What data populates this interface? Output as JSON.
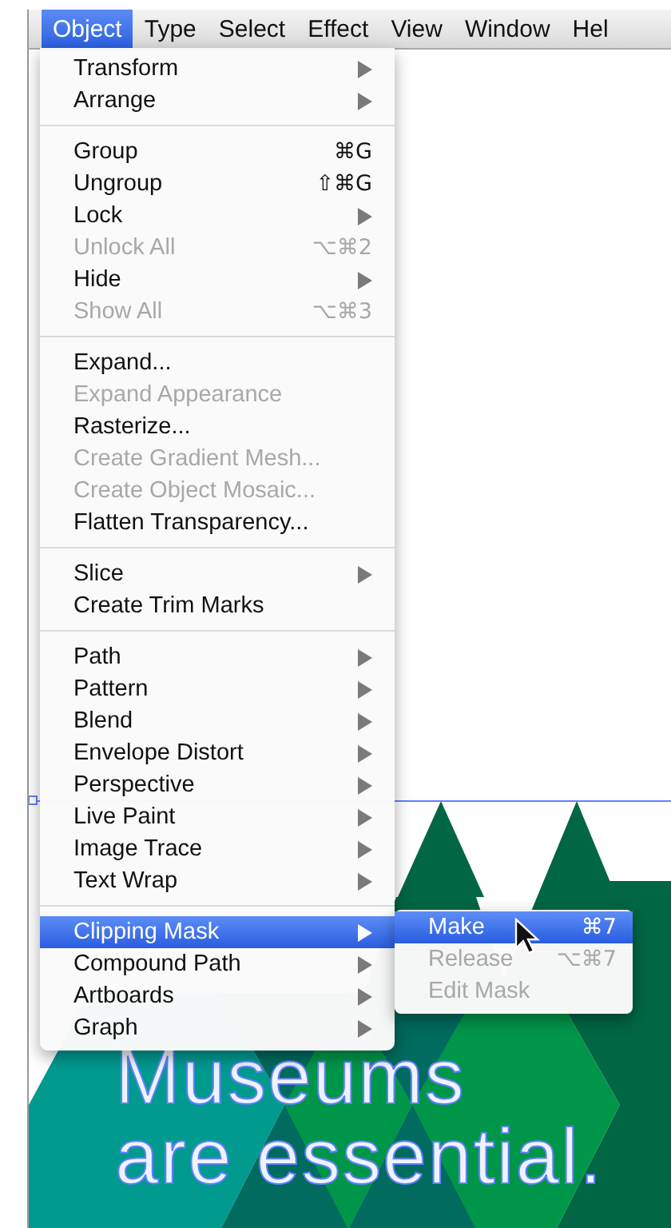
{
  "menubar": [
    {
      "label": "Object",
      "selected": true
    },
    {
      "label": "Type",
      "selected": false
    },
    {
      "label": "Select",
      "selected": false
    },
    {
      "label": "Effect",
      "selected": false
    },
    {
      "label": "View",
      "selected": false
    },
    {
      "label": "Window",
      "selected": false
    },
    {
      "label": "Hel",
      "selected": false
    }
  ],
  "menu": {
    "groups": [
      [
        {
          "label": "Transform",
          "submenu": true,
          "disabled": false,
          "selected": false
        },
        {
          "label": "Arrange",
          "submenu": true,
          "disabled": false,
          "selected": false
        }
      ],
      [
        {
          "label": "Group",
          "shortcut": "⌘G",
          "submenu": false,
          "disabled": false,
          "selected": false
        },
        {
          "label": "Ungroup",
          "shortcut": "⇧⌘G",
          "submenu": false,
          "disabled": false,
          "selected": false
        },
        {
          "label": "Lock",
          "submenu": true,
          "disabled": false,
          "selected": false
        },
        {
          "label": "Unlock All",
          "shortcut": "⌥⌘2",
          "submenu": false,
          "disabled": true,
          "selected": false
        },
        {
          "label": "Hide",
          "submenu": true,
          "disabled": false,
          "selected": false
        },
        {
          "label": "Show All",
          "shortcut": "⌥⌘3",
          "submenu": false,
          "disabled": true,
          "selected": false
        }
      ],
      [
        {
          "label": "Expand...",
          "submenu": false,
          "disabled": false,
          "selected": false
        },
        {
          "label": "Expand Appearance",
          "submenu": false,
          "disabled": true,
          "selected": false
        },
        {
          "label": "Rasterize...",
          "submenu": false,
          "disabled": false,
          "selected": false
        },
        {
          "label": "Create Gradient Mesh...",
          "submenu": false,
          "disabled": true,
          "selected": false
        },
        {
          "label": "Create Object Mosaic...",
          "submenu": false,
          "disabled": true,
          "selected": false
        },
        {
          "label": "Flatten Transparency...",
          "submenu": false,
          "disabled": false,
          "selected": false
        }
      ],
      [
        {
          "label": "Slice",
          "submenu": true,
          "disabled": false,
          "selected": false
        },
        {
          "label": "Create Trim Marks",
          "submenu": false,
          "disabled": false,
          "selected": false
        }
      ],
      [
        {
          "label": "Path",
          "submenu": true,
          "disabled": false,
          "selected": false
        },
        {
          "label": "Pattern",
          "submenu": true,
          "disabled": false,
          "selected": false
        },
        {
          "label": "Blend",
          "submenu": true,
          "disabled": false,
          "selected": false
        },
        {
          "label": "Envelope Distort",
          "submenu": true,
          "disabled": false,
          "selected": false
        },
        {
          "label": "Perspective",
          "submenu": true,
          "disabled": false,
          "selected": false
        },
        {
          "label": "Live Paint",
          "submenu": true,
          "disabled": false,
          "selected": false
        },
        {
          "label": "Image Trace",
          "submenu": true,
          "disabled": false,
          "selected": false
        },
        {
          "label": "Text Wrap",
          "submenu": true,
          "disabled": false,
          "selected": false
        }
      ],
      [
        {
          "label": "Clipping Mask",
          "submenu": true,
          "disabled": false,
          "selected": true
        },
        {
          "label": "Compound Path",
          "submenu": true,
          "disabled": false,
          "selected": false
        },
        {
          "label": "Artboards",
          "submenu": true,
          "disabled": false,
          "selected": false
        },
        {
          "label": "Graph",
          "submenu": true,
          "disabled": false,
          "selected": false
        }
      ]
    ]
  },
  "submenu": [
    {
      "label": "Make",
      "shortcut": "⌘7",
      "disabled": false,
      "selected": true
    },
    {
      "label": "Release",
      "shortcut": "⌥⌘7",
      "disabled": true,
      "selected": false
    },
    {
      "label": "Edit Mask",
      "disabled": true,
      "selected": false
    }
  ],
  "artwork": {
    "lines": [
      "Museums",
      "are essential."
    ]
  }
}
